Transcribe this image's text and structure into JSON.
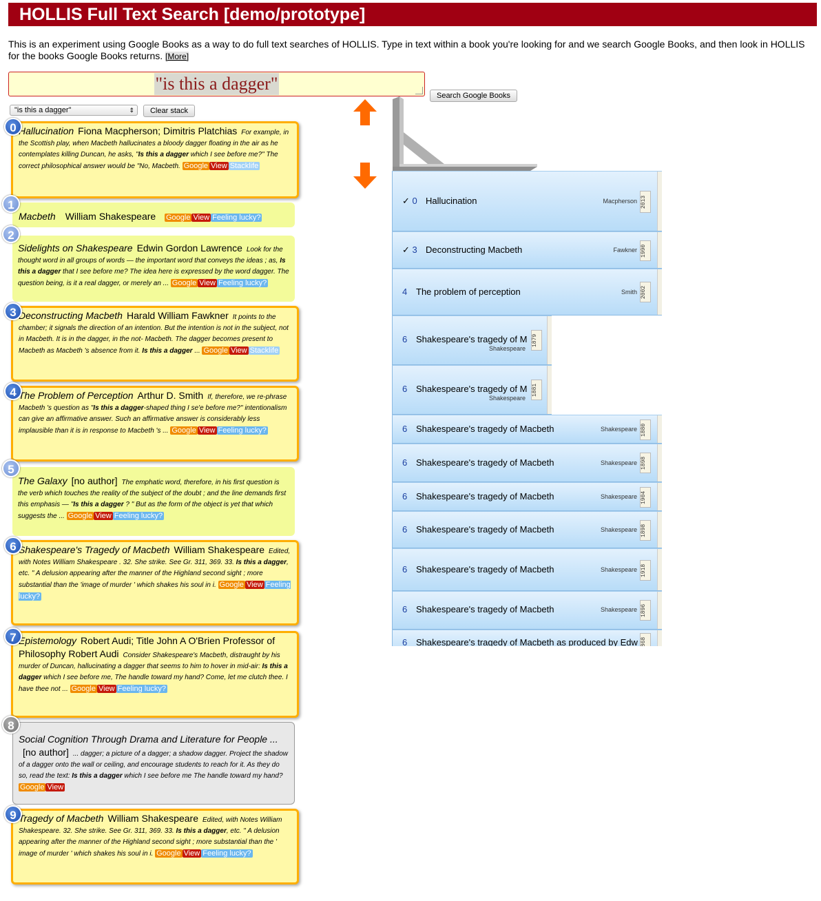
{
  "header": {
    "title": "HOLLIS Full Text Search [demo/prototype]"
  },
  "intro": {
    "text": "This is an experiment using Google Books as a way to do full text searches of HOLLIS. Type in text within a book you're looking for and we search Google Books, and then look in HOLLIS for the books Google Books returns.",
    "more_label": "[More]"
  },
  "search": {
    "value": "\"is this a dagger\"",
    "button_label": "Search Google Books"
  },
  "history": {
    "selected": "\"is this a dagger\"",
    "clear_label": "Clear stack"
  },
  "tags": {
    "google": "Google",
    "view": "View",
    "stacklife": "Stacklife",
    "lucky": "Feeling lucky?"
  },
  "colors": {
    "header": "#a00012",
    "arrow": "#ff6a00",
    "highlight_border": "#ffae00"
  },
  "results": [
    {
      "num": "0",
      "title": "Hallucination",
      "author": "Fiona Macpherson; Dimitris Platchias",
      "snippet": [
        {
          "t": "For example, in the Scottish play, when Macbeth hallucinates a bloody dagger floating in the air as he contemplates killing Duncan, he asks, \"",
          "b": false
        },
        {
          "t": "Is this a dagger",
          "b": true
        },
        {
          "t": " which I see before me?\" The correct philosophical answer would be \"No, Macbeth.",
          "b": false
        }
      ]
    },
    {
      "num": "1",
      "title": "Macbeth",
      "author": "William Shakespeare",
      "snippet": []
    },
    {
      "num": "2",
      "title": "Sidelights on Shakespeare",
      "author": "Edwin Gordon Lawrence",
      "snippet": [
        {
          "t": "Look for the thought word in all groups of words — the important word that conveys the ideas ; as, ",
          "b": false
        },
        {
          "t": "Is this a dagger",
          "b": true
        },
        {
          "t": " that I see before me? The idea here is expressed by the word dagger. The question being, is it a real dagger, or merely an ...",
          "b": false
        }
      ]
    },
    {
      "num": "3",
      "title": "Deconstructing Macbeth",
      "author": "Harald William Fawkner",
      "snippet": [
        {
          "t": "It points to the chamber; it signals the direction of an intention. But the intention is not in the subject, not in Macbeth. It is in the dagger, in the not- Macbeth. The dagger becomes present to Macbeth as Macbeth 's absence from it. ",
          "b": false
        },
        {
          "t": "Is this a dagger",
          "b": true
        },
        {
          "t": " ...",
          "b": false
        }
      ]
    },
    {
      "num": "4",
      "title": "The Problem of Perception",
      "author": "Arthur D. Smith",
      "snippet": [
        {
          "t": "If, therefore, we re-phrase Macbeth 's question as \"",
          "b": false
        },
        {
          "t": "Is this a dagger",
          "b": true
        },
        {
          "t": "-shaped thing I se'e before me?\" intentionalism can give an affirmative answer. Such an affirmative answer is considerably less implausible than it is in response to Macbeth 's ...",
          "b": false
        }
      ]
    },
    {
      "num": "5",
      "title": "The Galaxy",
      "author": "[no author]",
      "snippet": [
        {
          "t": "The emphatic word, therefore, in his first question is the verb which touches the reality of the subject of the doubt ; and the line demands first this emphasis — \"",
          "b": false
        },
        {
          "t": "Is this a dagger",
          "b": true
        },
        {
          "t": " ? \" But as the form of the object is yet that which suggests the ...",
          "b": false
        }
      ]
    },
    {
      "num": "6",
      "title": "Shakespeare's Tragedy of Macbeth",
      "author": "William Shakespeare",
      "snippet": [
        {
          "t": "Edited, with Notes William Shakespeare . 32. She strike. See Gr. 311, 369. 33. ",
          "b": false
        },
        {
          "t": "Is this a dagger",
          "b": true
        },
        {
          "t": ", etc. \" A delusion appearing after the manner of the Highland second sight ; more substantial than the 'image of murder ' which shakes his soul in i.",
          "b": false
        }
      ]
    },
    {
      "num": "7",
      "title": "Epistemology",
      "author": "Robert Audi; Title John A O'Brien Professor of Philosophy Robert Audi",
      "snippet": [
        {
          "t": "Consider Shakespeare's Macbeth, distraught by his murder of Duncan, hallucinating a dagger that seems to him to hover in mid-air: ",
          "b": false
        },
        {
          "t": "Is this a dagger",
          "b": true
        },
        {
          "t": " which I see before me, The handle toward my hand? Come, let me clutch thee. I have thee not ...",
          "b": false
        }
      ]
    },
    {
      "num": "8",
      "title": "Social Cognition Through Drama and Literature for People ...",
      "author": "[no author]",
      "snippet": [
        {
          "t": "... dagger; a picture of a dagger; a shadow dagger. Project the shadow of a dagger onto the wall or ceiling, and encourage students to reach for it. As they do so, read the text: ",
          "b": false
        },
        {
          "t": "Is this a dagger",
          "b": true
        },
        {
          "t": " which I see before me The handle toward my hand?",
          "b": false
        }
      ]
    },
    {
      "num": "9",
      "title": "Tragedy of Macbeth",
      "author": "William Shakespeare",
      "snippet": [
        {
          "t": "Edited, with Notes William Shakespeare. 32. She strike. See Gr. 311, 369. 33. ",
          "b": false
        },
        {
          "t": "Is this a dagger",
          "b": true
        },
        {
          "t": ", etc. \" A delusion appearing after the manner of the Highland second sight ; more substantial than the ' image of murder ' which shakes his soul in i.",
          "b": false
        }
      ]
    }
  ],
  "stack": [
    {
      "check": "✓",
      "num": "0",
      "title": "Hallucination",
      "author": "Macpherson",
      "year": "2013"
    },
    {
      "check": "✓",
      "num": "3",
      "title": "Deconstructing Macbeth",
      "author": "Fawkner",
      "year": "1990"
    },
    {
      "check": "",
      "num": "4",
      "title": "The problem of perception",
      "author": "Smith",
      "year": "2002"
    },
    {
      "check": "",
      "num": "6",
      "title": "Shakespeare's tragedy of M",
      "author": "Shakespeare",
      "year": "1879"
    },
    {
      "check": "",
      "num": "6",
      "title": "Shakespeare's tragedy of M",
      "author": "Shakespeare",
      "year": "1881"
    },
    {
      "check": "",
      "num": "6",
      "title": "Shakespeare's tragedy of Macbeth",
      "author": "Shakespeare",
      "year": "1880"
    },
    {
      "check": "",
      "num": "6",
      "title": "Shakespeare's tragedy of Macbeth",
      "author": "Shakespeare",
      "year": "1898"
    },
    {
      "check": "",
      "num": "6",
      "title": "Shakespeare's tragedy of Macbeth",
      "author": "Shakespeare",
      "year": "1904"
    },
    {
      "check": "",
      "num": "6",
      "title": "Shakespeare's tragedy of Macbeth",
      "author": "Shakespeare",
      "year": "1898"
    },
    {
      "check": "",
      "num": "6",
      "title": "Shakespeare's tragedy of Macbeth",
      "author": "Shakespeare",
      "year": "1918"
    },
    {
      "check": "",
      "num": "6",
      "title": "Shakespeare's tragedy of Macbeth",
      "author": "Shakespeare",
      "year": "1896"
    },
    {
      "check": "",
      "num": "6",
      "title": "Shakespeare's tragedy of Macbeth as produced by Edw",
      "author": "",
      "year": "1868"
    }
  ]
}
